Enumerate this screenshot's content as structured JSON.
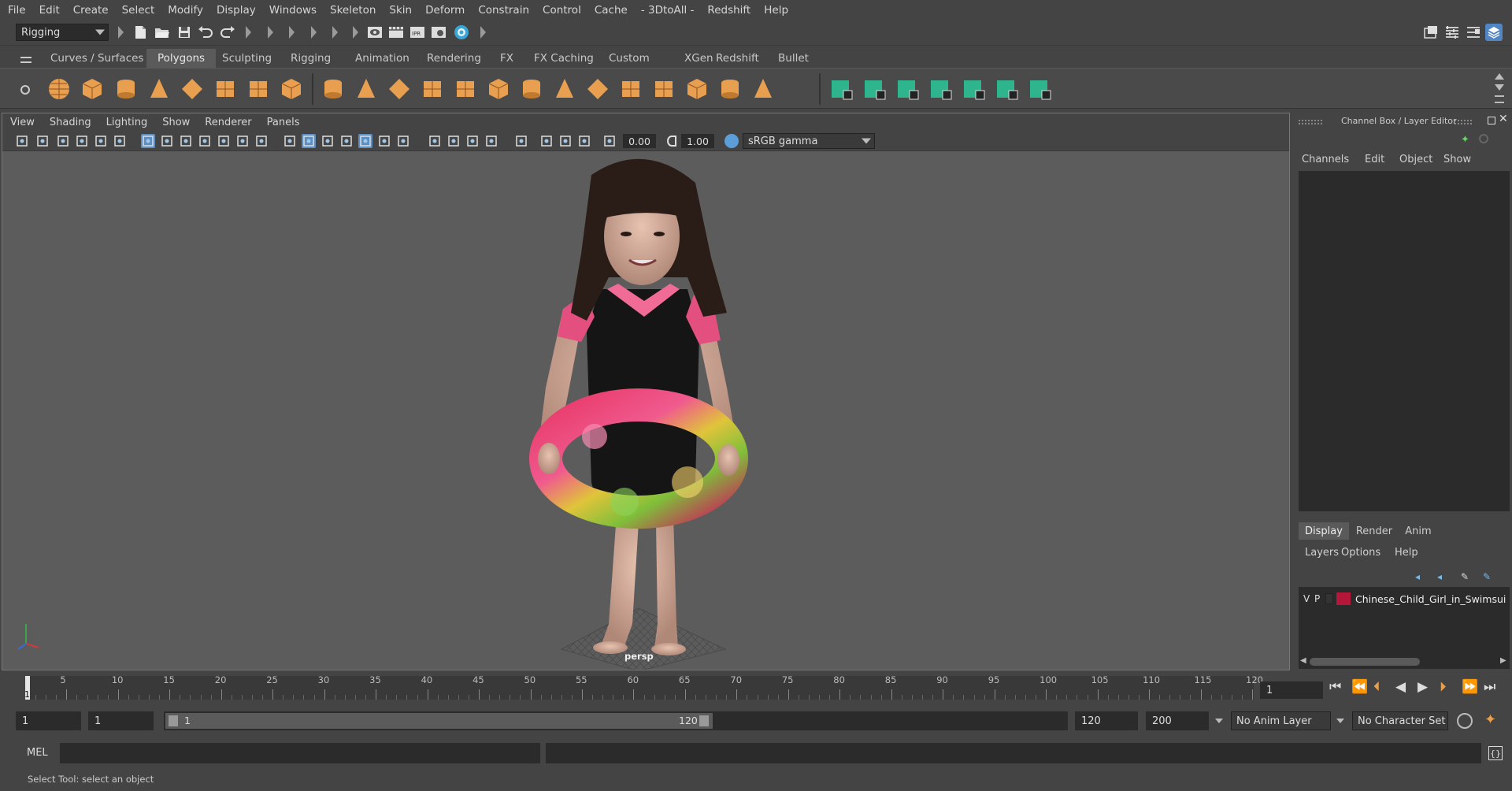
{
  "menubar": {
    "items": [
      "File",
      "Edit",
      "Create",
      "Select",
      "Modify",
      "Display",
      "Windows",
      "Skeleton",
      "Skin",
      "Deform",
      "Constrain",
      "Control",
      "Cache",
      "- 3DtoAll -",
      "Redshift",
      "Help"
    ]
  },
  "statusline": {
    "menuset": "Rigging"
  },
  "shelf": {
    "tabs": [
      "Curves / Surfaces",
      "Polygons",
      "Sculpting",
      "Rigging",
      "Animation",
      "Rendering",
      "FX",
      "FX Caching",
      "Custom",
      "XGen",
      "Redshift",
      "Bullet"
    ],
    "active_tab": "Polygons",
    "icon_names": [
      "poly-sphere-icon",
      "poly-cube-icon",
      "poly-cylinder-icon",
      "poly-cone-icon",
      "poly-plane-icon",
      "poly-torus-icon",
      "poly-pyramid-icon",
      "poly-pipe-icon",
      "combine-icon",
      "separate-icon",
      "extract-icon",
      "smooth-icon",
      "bridge-icon",
      "extrude-icon",
      "multicut-icon",
      "bevel-icon",
      "append-icon",
      "fill-hole-icon",
      "merge-icon",
      "target-weld-icon",
      "insert-edge-loop-icon",
      "offset-edge-loop-icon",
      "planar-uv-icon",
      "auto-uv-icon",
      "cylindrical-uv-icon",
      "spherical-uv-icon",
      "sew-uv-icon",
      "uv-editor-icon",
      "symmetry-icon"
    ]
  },
  "viewport": {
    "menu": [
      "View",
      "Shading",
      "Lighting",
      "Show",
      "Renderer",
      "Panels"
    ],
    "exposure": "0.00",
    "gamma": "1.00",
    "color_space": "sRGB gamma",
    "camera_label": "persp"
  },
  "channelbox": {
    "title": "Channel Box / Layer Editor",
    "menu": [
      "Channels",
      "Edit",
      "Object",
      "Show"
    ]
  },
  "layereditor": {
    "tabs": [
      "Display",
      "Render",
      "Anim"
    ],
    "active_tab": "Display",
    "menu": [
      "Layers",
      "Options",
      "Help"
    ],
    "layers": [
      {
        "visible": "V",
        "playback": "P",
        "color": "#b5173a",
        "name": "Chinese_Child_Girl_in_Swimsui"
      }
    ]
  },
  "timeline": {
    "ticks": [
      "5",
      "10",
      "15",
      "20",
      "25",
      "30",
      "35",
      "40",
      "45",
      "50",
      "55",
      "60",
      "65",
      "70",
      "75",
      "80",
      "85",
      "90",
      "95",
      "100",
      "105",
      "110",
      "115",
      "120"
    ],
    "start_label": "1",
    "current_frame": "1"
  },
  "range": {
    "start": "1",
    "playback_start": "1",
    "slider_start": "1",
    "slider_end": "120",
    "playback_end": "120",
    "end": "200",
    "anim_layer": "No Anim Layer",
    "character_set": "No Character Set"
  },
  "commandline": {
    "label": "MEL"
  },
  "helpline": {
    "text": "Select Tool: select an object"
  },
  "colors": {
    "accent": "#5c8fc4",
    "shelf_orange": "#e8a050",
    "shelf_green": "#2fb58e",
    "layer_color": "#b5173a"
  }
}
